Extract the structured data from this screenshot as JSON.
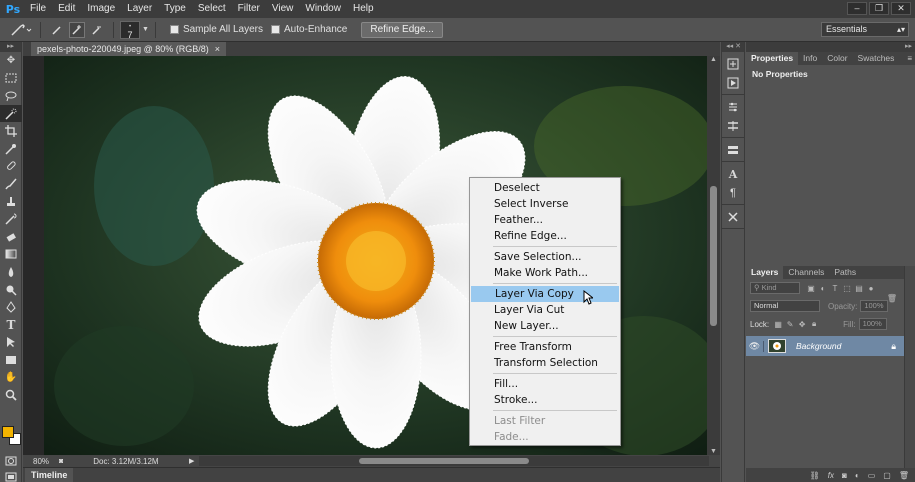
{
  "app": {
    "logo": "Ps"
  },
  "menu": [
    "File",
    "Edit",
    "Image",
    "Layer",
    "Type",
    "Select",
    "Filter",
    "View",
    "Window",
    "Help"
  ],
  "window_controls": [
    "–",
    "❐",
    "✕"
  ],
  "options_bar": {
    "brush_size": "7",
    "sample_all_layers": "Sample All Layers",
    "auto_enhance": "Auto-Enhance",
    "refine_edge": "Refine Edge...",
    "workspace": "Essentials"
  },
  "document": {
    "tab_title": "pexels-photo-220049.jpeg @ 80% (RGB/8)",
    "close": "×"
  },
  "status": {
    "zoom": "80%",
    "doc_info": "Doc: 3.12M/3.12M"
  },
  "timeline_label": "Timeline",
  "context_menu": {
    "items": [
      "Deselect",
      "Select Inverse",
      "Feather...",
      "Refine Edge...",
      "Save Selection...",
      "Make Work Path...",
      "Layer Via Copy",
      "Layer Via Cut",
      "New Layer...",
      "Free Transform",
      "Transform Selection",
      "Fill...",
      "Stroke...",
      "Last Filter",
      "Fade..."
    ],
    "highlighted": "Layer Via Copy",
    "disabled": [
      "Last Filter",
      "Fade..."
    ]
  },
  "properties_panel": {
    "tabs": [
      "Properties",
      "Info",
      "Color",
      "Swatches"
    ],
    "body_text": "No Properties"
  },
  "layers_panel": {
    "tabs": [
      "Layers",
      "Channels",
      "Paths"
    ],
    "filter_kind": "Kind",
    "blend_mode": "Normal",
    "opacity_label": "Opacity:",
    "opacity_value": "100%",
    "lock_label": "Lock:",
    "fill_label": "Fill:",
    "fill_value": "100%",
    "layers": [
      {
        "name": "Background",
        "locked": true,
        "visible": true
      }
    ]
  },
  "colors": {
    "foreground": "#f4b400",
    "background": "#ffffff",
    "menu_highlight": "#99c9ef",
    "layer_selected": "#6f88a4",
    "app_accent": "#31a8ff"
  }
}
